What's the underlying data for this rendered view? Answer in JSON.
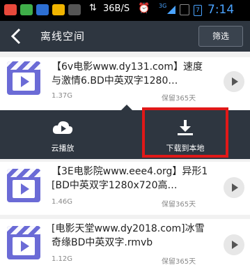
{
  "status_bar": {
    "network_speed": "36B/S",
    "signal_label": "3G",
    "battery_label": "7",
    "time": "7:14"
  },
  "header": {
    "title": "离线空间",
    "filter_label": "筛选"
  },
  "items": [
    {
      "name": "【6v电影www.dy131.com】速度与激情6.BD中英双字1280…",
      "size": "1.37G",
      "expire": "保留365天"
    },
    {
      "name": "【3E电影院www.eee4.org】异形1[BD中英双字1280x720高…",
      "size": "1.46G",
      "expire": "保留365天"
    },
    {
      "name": "[电影天堂www.dy2018.com]冰雪奇缘BD中英双字.rmvb",
      "size": "1.12G",
      "expire": "保留365天"
    }
  ],
  "actions": {
    "cloud_play_label": "云播放",
    "download_label": "下载到本地"
  },
  "colors": {
    "header_bg": "#2e3640",
    "thumb_accent": "#6b6bd6",
    "highlight": "#e01818"
  }
}
